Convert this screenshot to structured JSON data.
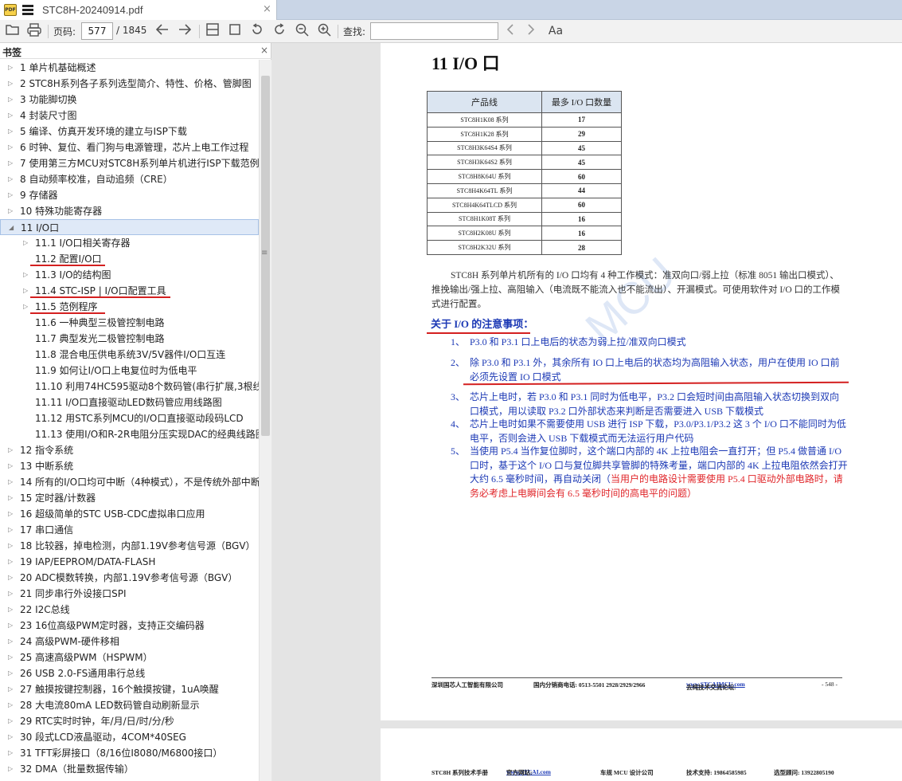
{
  "tab": {
    "title": "STC8H-20240914.pdf",
    "close": "×",
    "app_icon": "PDF"
  },
  "toolbar": {
    "page_label": "页码:",
    "current_page": "577",
    "page_total": "/ 1845",
    "search_label": "查找:",
    "search_placeholder": "",
    "font_button": "Aa",
    "icons": [
      "open-icon",
      "print-icon",
      "prev-page-icon",
      "next-page-icon",
      "fit-width-icon",
      "fit-page-icon",
      "rotate-left-icon",
      "rotate-right-icon",
      "zoom-out-icon",
      "zoom-in-icon",
      "find-prev-icon",
      "find-next-icon",
      "font-icon"
    ]
  },
  "sidebar": {
    "title": "书签",
    "close": "×",
    "items": [
      {
        "label": "1 单片机基础概述",
        "level": 0,
        "expandable": true
      },
      {
        "label": "2 STC8H系列各子系列选型简介、特性、价格、管脚图",
        "level": 0,
        "expandable": true
      },
      {
        "label": "3 功能脚切换",
        "level": 0,
        "expandable": true
      },
      {
        "label": "4 封装尺寸图",
        "level": 0,
        "expandable": true
      },
      {
        "label": "5 编译、仿真开发环境的建立与ISP下载",
        "level": 0,
        "expandable": true
      },
      {
        "label": "6 时钟、复位、看门狗与电源管理，芯片上电工作过程",
        "level": 0,
        "expandable": true
      },
      {
        "label": "7 使用第三方MCU对STC8H系列单片机进行ISP下载范例",
        "level": 0,
        "expandable": true
      },
      {
        "label": "8 自动频率校准，自动追频（CRE）",
        "level": 0,
        "expandable": true
      },
      {
        "label": "9 存储器",
        "level": 0,
        "expandable": true
      },
      {
        "label": "10 特殊功能寄存器",
        "level": 0,
        "expandable": true
      },
      {
        "label": "11 I/O口",
        "level": 0,
        "expandable": true,
        "expanded": true,
        "selected": true
      },
      {
        "label": "11.1 I/O口相关寄存器",
        "level": 1,
        "expandable": true
      },
      {
        "label": "11.2 配置I/O口",
        "level": 1,
        "expandable": false,
        "underlined": true
      },
      {
        "label": "11.3 I/O的结构图",
        "level": 1,
        "expandable": true
      },
      {
        "label": "11.4 STC-ISP | I/O口配置工具",
        "level": 1,
        "expandable": true,
        "underlined": true
      },
      {
        "label": "11.5 范例程序",
        "level": 1,
        "expandable": true,
        "underlined": true
      },
      {
        "label": "11.6 一种典型三极管控制电路",
        "level": 1,
        "expandable": false
      },
      {
        "label": "11.7 典型发光二极管控制电路",
        "level": 1,
        "expandable": false
      },
      {
        "label": "11.8 混合电压供电系统3V/5V器件I/O口互连",
        "level": 1,
        "expandable": false
      },
      {
        "label": "11.9 如何让I/O口上电复位时为低电平",
        "level": 1,
        "expandable": false
      },
      {
        "label": "11.10 利用74HC595驱动8个数码管(串行扩展,3根线)",
        "level": 1,
        "expandable": false
      },
      {
        "label": "11.11 I/O口直接驱动LED数码管应用线路图",
        "level": 1,
        "expandable": false
      },
      {
        "label": "11.12 用STC系列MCU的I/O口直接驱动段码LCD",
        "level": 1,
        "expandable": false
      },
      {
        "label": "11.13 使用I/O和R-2R电阻分压实现DAC的经典线路图",
        "level": 1,
        "expandable": false
      },
      {
        "label": "12 指令系统",
        "level": 0,
        "expandable": true
      },
      {
        "label": "13 中断系统",
        "level": 0,
        "expandable": true
      },
      {
        "label": "14 所有的I/O口均可中断（4种模式），不是传统外部中断",
        "level": 0,
        "expandable": true
      },
      {
        "label": "15 定时器/计数器",
        "level": 0,
        "expandable": true
      },
      {
        "label": "16 超级简单的STC USB-CDC虚拟串口应用",
        "level": 0,
        "expandable": true
      },
      {
        "label": "17 串口通信",
        "level": 0,
        "expandable": true
      },
      {
        "label": "18 比较器，掉电检测，内部1.19V参考信号源（BGV）",
        "level": 0,
        "expandable": true
      },
      {
        "label": "19 IAP/EEPROM/DATA-FLASH",
        "level": 0,
        "expandable": true
      },
      {
        "label": "20 ADC模数转换，内部1.19V参考信号源（BGV）",
        "level": 0,
        "expandable": true
      },
      {
        "label": "21 同步串行外设接口SPI",
        "level": 0,
        "expandable": true
      },
      {
        "label": "22 I2C总线",
        "level": 0,
        "expandable": true
      },
      {
        "label": "23 16位高级PWM定时器，支持正交编码器",
        "level": 0,
        "expandable": true
      },
      {
        "label": "24 高级PWM-硬件移相",
        "level": 0,
        "expandable": true
      },
      {
        "label": "25 高速高级PWM（HSPWM）",
        "level": 0,
        "expandable": true
      },
      {
        "label": "26 USB 2.0-FS通用串行总线",
        "level": 0,
        "expandable": true
      },
      {
        "label": "27 触摸按键控制器，16个触摸按键，1uA唤醒",
        "level": 0,
        "expandable": true
      },
      {
        "label": "28 大电流80mA LED数码管自动刷新显示",
        "level": 0,
        "expandable": true
      },
      {
        "label": "29 RTC实时时钟，年/月/日/时/分/秒",
        "level": 0,
        "expandable": true
      },
      {
        "label": "30 段式LCD液晶驱动，4COM*40SEG",
        "level": 0,
        "expandable": true
      },
      {
        "label": "31 TFT彩屏接口（8/16位I8080/M6800接口）",
        "level": 0,
        "expandable": true
      },
      {
        "label": "32 DMA（批量数据传输）",
        "level": 0,
        "expandable": true
      }
    ]
  },
  "document": {
    "heading": "11 I/O 口",
    "table": {
      "headers": [
        "产品线",
        "最多 I/O 口数量"
      ],
      "rows": [
        [
          "STC8H1K08 系列",
          "17"
        ],
        [
          "STC8H1K28 系列",
          "29"
        ],
        [
          "STC8H3K64S4 系列",
          "45"
        ],
        [
          "STC8H3K64S2 系列",
          "45"
        ],
        [
          "STC8H8K64U 系列",
          "60"
        ],
        [
          "STC8H4K64TL 系列",
          "44"
        ],
        [
          "STC8H4K64TLCD 系列",
          "60"
        ],
        [
          "STC8H1K08T 系列",
          "16"
        ],
        [
          "STC8H2K08U 系列",
          "16"
        ],
        [
          "STC8H2K32U 系列",
          "28"
        ]
      ]
    },
    "intro": "STC8H 系列单片机所有的 I/O 口均有 4 种工作模式：准双向口/弱上拉（标准 8051 输出口模式）、推挽输出/强上拉、高阻输入（电流既不能流入也不能流出）、开漏模式。可使用软件对 I/O 口的工作模式进行配置。",
    "notes_title": "关于 I/O 的注意事项：",
    "notes": [
      {
        "num": "1、",
        "text": "P3.0 和 P3.1 口上电后的状态为弱上拉/准双向口模式",
        "red": ""
      },
      {
        "num": "2、",
        "text": "除 P3.0 和 P3.1 外，其余所有 IO 口上电后的状态均为高阻输入状态，用户在使用 IO 口前必须先设置 IO 口模式",
        "red": ""
      },
      {
        "num": "3、",
        "text": "芯片上电时，若 P3.0 和 P3.1 同时为低电平，P3.2 口会短时间由高阻输入状态切换到双向口模式，用以读取 P3.2 口外部状态来判断是否需要进入 USB 下载模式",
        "red": ""
      },
      {
        "num": "4、",
        "text": "芯片上电时如果不需要使用 USB 进行 ISP 下载，P3.0/P3.1/P3.2 这 3 个 I/O 口不能同时为低电平，否则会进入 USB 下载模式而无法运行用户代码",
        "red": ""
      },
      {
        "num": "5、",
        "text": "当使用 P5.4 当作复位脚时，这个端口内部的 4K 上拉电阻会一直打开；但 P5.4 做普通 I/O 口时，基于这个 I/O 口与复位脚共享管脚的特殊考量，端口内部的 4K 上拉电阻依然会打开大约 6.5 毫秒时间，再自动关闭（",
        "red": "当用户的电路设计需要使用 P5.4 口驱动外部电路时，请务必考虑上电瞬间会有 6.5 毫秒时间的高电平的问题）"
      }
    ],
    "watermark": "MCU",
    "footer": {
      "company": "深圳国芯人工智能有限公司",
      "phone": "国内分销商电话: 0513-5501 2928/2929/2966",
      "forum_label": "去纯技术交流论坛:",
      "forum_url": "www.STCAIMCU.com",
      "page": "- 548 -"
    },
    "footer2": {
      "manual": "STC8H 系列技术手册",
      "site_label": "官方网站:",
      "site_url": "www.STCAI.com",
      "design": "车规 MCU 设计公司",
      "support": "技术支持: 19864585985",
      "advisor": "选型顾问: 13922805190"
    }
  },
  "colors": {
    "accent_blue": "#1c39b5",
    "warning_red": "#e0262a",
    "table_header": "#dbe5f1",
    "selection": "#dfe9f7"
  }
}
